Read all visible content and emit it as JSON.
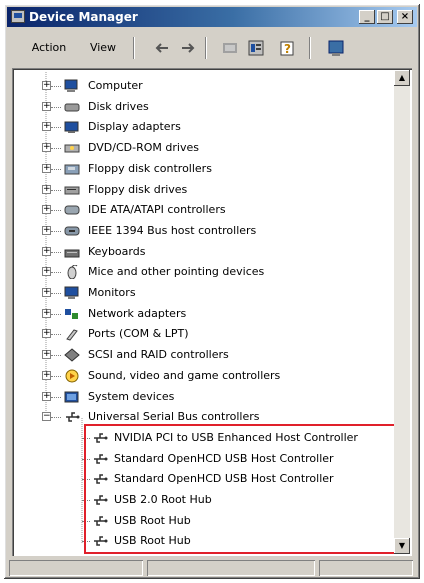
{
  "window": {
    "title": "Device Manager"
  },
  "caption_buttons": {
    "minimize": "_",
    "maximize": "□",
    "close": "×"
  },
  "toolbar": {
    "action_label": "Action",
    "view_label": "View"
  },
  "tree": {
    "categories": [
      {
        "label": "Computer",
        "icon": "computer-icon"
      },
      {
        "label": "Disk drives",
        "icon": "disk-drive-icon"
      },
      {
        "label": "Display adapters",
        "icon": "display-adapter-icon"
      },
      {
        "label": "DVD/CD-ROM drives",
        "icon": "cdrom-icon"
      },
      {
        "label": "Floppy disk controllers",
        "icon": "floppy-controller-icon"
      },
      {
        "label": "Floppy disk drives",
        "icon": "floppy-drive-icon"
      },
      {
        "label": "IDE ATA/ATAPI controllers",
        "icon": "ide-controller-icon"
      },
      {
        "label": "IEEE 1394 Bus host controllers",
        "icon": "ieee1394-icon"
      },
      {
        "label": "Keyboards",
        "icon": "keyboard-icon"
      },
      {
        "label": "Mice and other pointing devices",
        "icon": "mouse-icon"
      },
      {
        "label": "Monitors",
        "icon": "monitor-icon"
      },
      {
        "label": "Network adapters",
        "icon": "network-adapter-icon"
      },
      {
        "label": "Ports (COM & LPT)",
        "icon": "port-icon"
      },
      {
        "label": "SCSI and RAID controllers",
        "icon": "scsi-icon"
      },
      {
        "label": "Sound, video and game controllers",
        "icon": "sound-icon"
      },
      {
        "label": "System devices",
        "icon": "system-device-icon"
      },
      {
        "label": "Universal Serial Bus controllers",
        "icon": "usb-icon",
        "expanded": true
      }
    ],
    "usb_children": [
      {
        "label": "NVIDIA PCI to USB Enhanced Host Controller"
      },
      {
        "label": "Standard OpenHCD USB Host Controller"
      },
      {
        "label": "Standard OpenHCD USB Host Controller"
      },
      {
        "label": "USB 2.0 Root Hub"
      },
      {
        "label": "USB Root Hub"
      },
      {
        "label": "USB Root Hub"
      }
    ]
  },
  "colors": {
    "highlight_box": "#e0202a",
    "titlebar_start": "#0a246a",
    "titlebar_end": "#a6caf0"
  }
}
